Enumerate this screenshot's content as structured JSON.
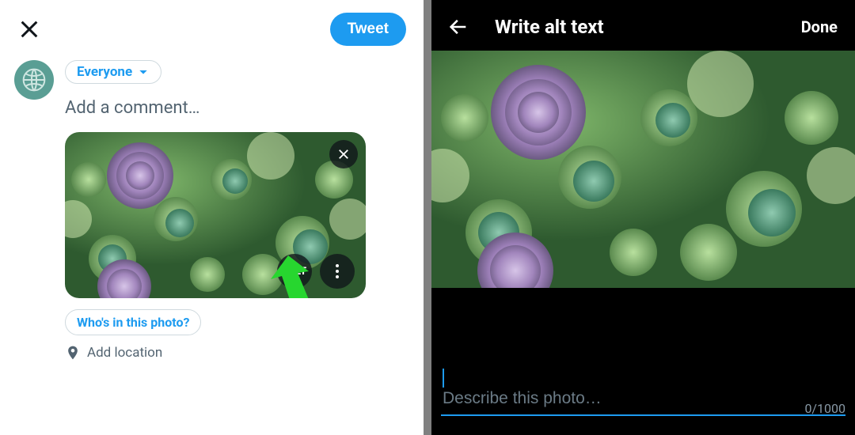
{
  "left": {
    "tweet_button": "Tweet",
    "audience_label": "Everyone",
    "comment_placeholder": "Add a comment…",
    "media": {
      "alt_button_label": "+ALT"
    },
    "tag_people_label": "Who's in this photo?",
    "add_location_label": "Add location"
  },
  "right": {
    "title": "Write alt text",
    "done_label": "Done",
    "alt_placeholder": "Describe this photo…",
    "alt_value": "",
    "counter": "0/1000"
  }
}
